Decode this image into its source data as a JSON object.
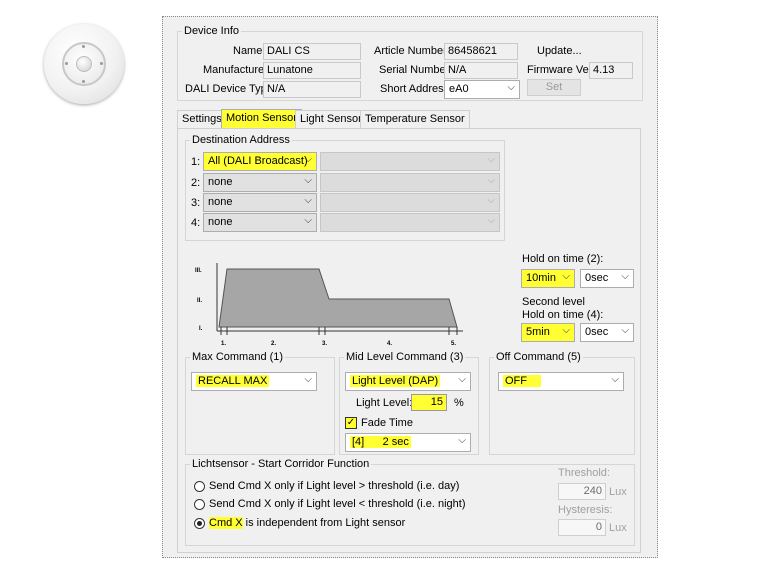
{
  "sensor_image": {
    "name": "DALI motion sensor device"
  },
  "device_info": {
    "legend": "Device Info",
    "name_label": "Name",
    "name_value": "DALI CS",
    "manufacturer_label": "Manufacturer",
    "manufacturer_value": "Lunatone",
    "device_type_label": "DALI Device Type",
    "device_type_value": "N/A",
    "article_label": "Article Number",
    "article_value": "86458621",
    "serial_label": "Serial Number",
    "serial_value": "N/A",
    "short_addr_label": "Short Address",
    "short_addr_value": "eA0",
    "update_label": "Update...",
    "firmware_label": "Firmware Ver",
    "firmware_value": "4.13",
    "set_label": "Set"
  },
  "tabs": [
    {
      "label": "Settings",
      "active": false
    },
    {
      "label": "Motion Sensor",
      "active": true
    },
    {
      "label": "Light Sensor",
      "active": false
    },
    {
      "label": "Temperature Sensor",
      "active": false
    }
  ],
  "destination": {
    "legend": "Destination Address",
    "rows": [
      {
        "num": "1:",
        "value": "All (DALI Broadcast)",
        "highlight": true
      },
      {
        "num": "2:",
        "value": "none",
        "highlight": false
      },
      {
        "num": "3:",
        "value": "none",
        "highlight": false
      },
      {
        "num": "4:",
        "value": "none",
        "highlight": false
      }
    ]
  },
  "diagram": {
    "levels": [
      "III.",
      "II.",
      "I."
    ],
    "steps": [
      "1.",
      "2.",
      "3.",
      "4.",
      "5."
    ]
  },
  "hold_on": {
    "label": "Hold on time (2):",
    "min_value": "10min",
    "sec_value": "0sec",
    "second_level_label": "Second level",
    "second_hold_label": "Hold on time (4):",
    "second_min_value": "5min",
    "second_sec_value": "0sec"
  },
  "max_command": {
    "legend": "Max Command (1)",
    "value": "RECALL MAX"
  },
  "mid_command": {
    "legend": "Mid Level Command (3)",
    "value": "Light Level (DAP)",
    "light_level_label": "Light Level:",
    "light_level_value": "15",
    "light_level_unit": "%",
    "fade_label": "Fade Time",
    "fade_checked": true,
    "fade_value": "[4]      2 sec"
  },
  "off_command": {
    "legend": "Off Command (5)",
    "value": "OFF"
  },
  "lichtsensor": {
    "legend": "Lichtsensor - Start Corridor Function",
    "options": [
      {
        "label": "Send Cmd X only if Light level > threshold (i.e. day)",
        "checked": false
      },
      {
        "label": "Send Cmd X only if Light level < threshold (i.e. night)",
        "checked": false
      },
      {
        "label_hl": "Cmd X",
        "label_rest": " is independent from Light sensor",
        "checked": true
      }
    ],
    "threshold_label": "Threshold:",
    "threshold_value": "240",
    "threshold_unit": "Lux",
    "hysteresis_label": "Hysteresis:",
    "hysteresis_value": "0",
    "hysteresis_unit": "Lux"
  },
  "colors": {
    "highlight": "#ffff33",
    "diagram_fill": "#a6a6a6"
  }
}
